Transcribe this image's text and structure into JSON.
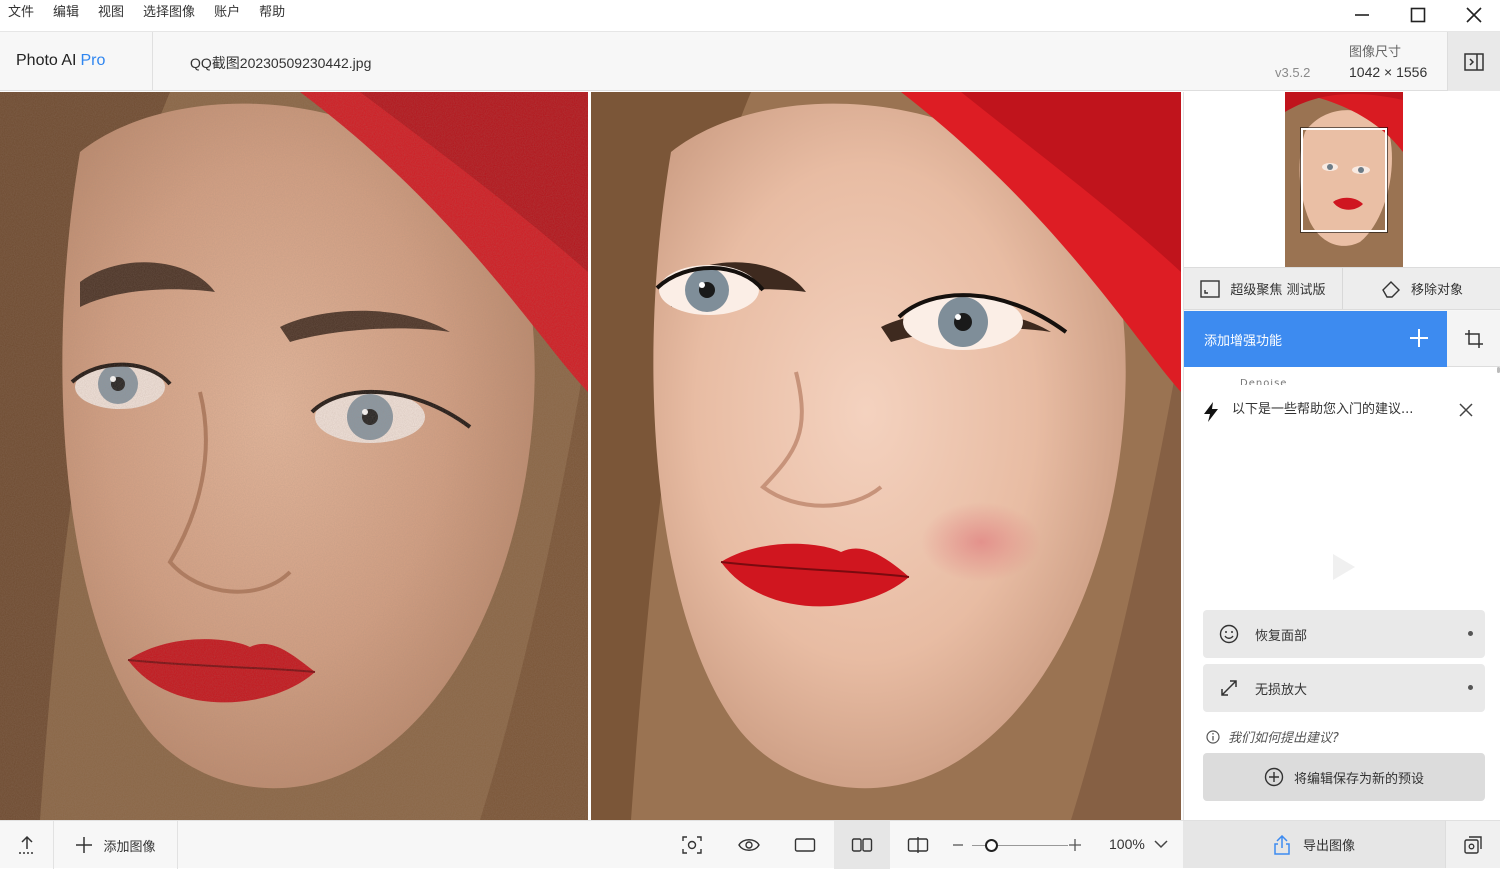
{
  "menu": [
    "文件",
    "编辑",
    "视图",
    "选择图像",
    "账户",
    "帮助"
  ],
  "header": {
    "brand": "Photo AI",
    "brand_tier": "Pro",
    "filename": "QQ截图20230509230442.jpg",
    "version": "v3.5.2",
    "size_label": "图像尺寸",
    "size_value": "1042 × 1556"
  },
  "panel": {
    "tools": {
      "super_focus": "超级聚焦 测试版",
      "remove_object": "移除对象"
    },
    "add_enhancement": "添加增强功能",
    "tip_ghost": "Denoise",
    "tip_text": "以下是一些帮助您入门的建议...",
    "features": {
      "recover_faces": "恢复面部",
      "upscale": "无损放大"
    },
    "help_link": "我们如何提出建议?",
    "save_preset": "将编辑保存为新的预设",
    "export": "导出图像"
  },
  "bottom": {
    "add_image": "添加图像",
    "zoom": "100%",
    "zoom_level": 0.2
  },
  "colors": {
    "accent": "#3d8bf0",
    "brand_tier": "#2f86f0"
  }
}
